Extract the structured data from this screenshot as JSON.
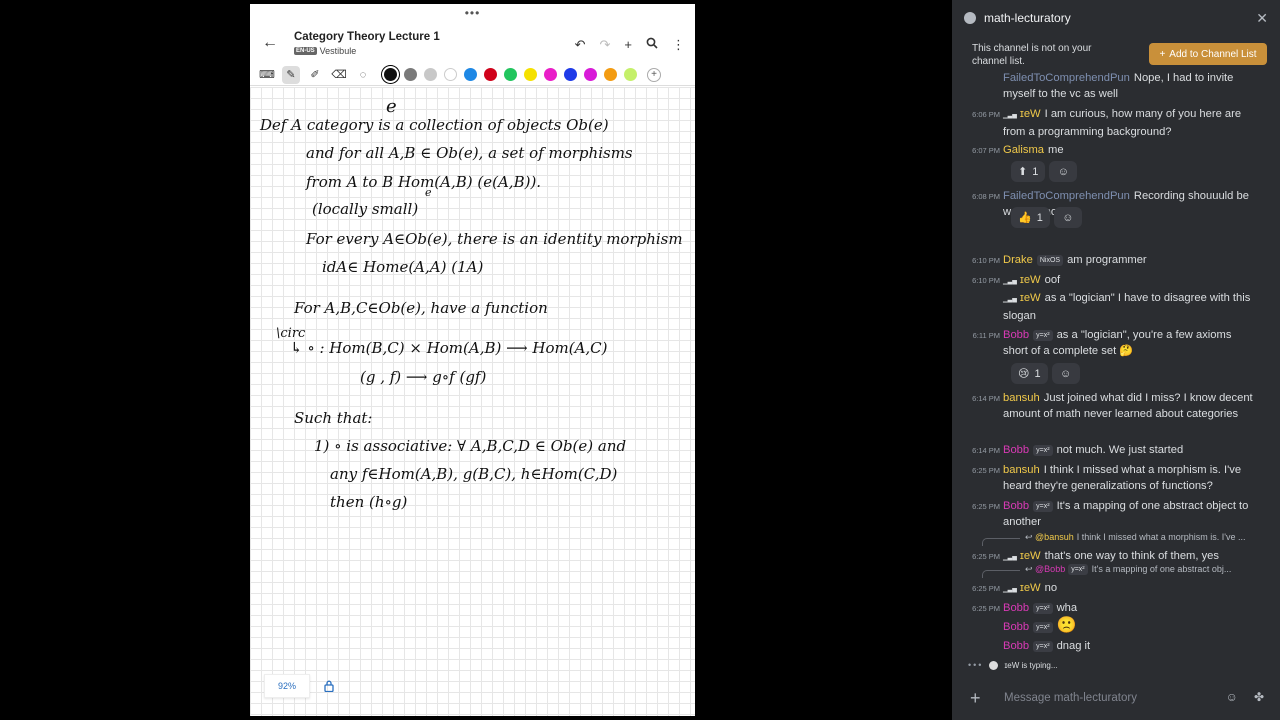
{
  "note": {
    "top_dots": "•••",
    "title": "Category Theory Lecture 1",
    "lang_badge": "EN-US",
    "notebook": "Vestibule",
    "zoom": "92%",
    "colors": [
      "#111111",
      "#7a7a7a",
      "#c8c8c8",
      "#ffffff",
      "#1e88e5",
      "#d0021b",
      "#22c55e",
      "#f5e100",
      "#e91ec8",
      "#1f3be8",
      "#d81bd8",
      "#f39c12",
      "#c5f06a"
    ],
    "handwriting": {
      "curly_e": "e",
      "l1": "Def   A category is a collection of objects Ob(e)",
      "l2": "and for all A,B ∈ Ob(e), a set of morphisms",
      "l3": "from A to B  Hom(A,B)  (e(A,B)).",
      "l3_sub": "e",
      "l4": "(locally small)",
      "l5": "For every A∈Ob(e), there is an identity morphism",
      "l6": "idA∈ Home(A,A)    (1A)",
      "l7": "For A,B,C∈Ob(e), have a function",
      "l8a": "\\circ",
      "l8": "↳ ∘ : Hom(B,C) × Hom(A,B) ⟶ Hom(A,C)",
      "l9": "(g  ,  f)        ⟶    g∘f     (gf)",
      "l10": "Such that:",
      "l11": "1)  ∘ is associative: ∀ A,B,C,D ∈ Ob(e) and",
      "l12": "any   f∈Hom(A,B), g(B,C), h∈Hom(C,D)",
      "l13": "then  (h∘g)"
    }
  },
  "chat": {
    "channel": "math-lecturatory",
    "notice": "This channel is not on your channel list.",
    "add_button": "Add to Channel List",
    "placeholder": "Message math-lecturatory",
    "typing": "ɪeW is typing...",
    "colors": {
      "FailedToComprehendPun": "#7e8fb0",
      "ɪeW": "#f0c94a",
      "Galisma": "#f0c94a",
      "Drake": "#f0c94a",
      "Bobb": "#d83ab5",
      "bansuh": "#f0c94a"
    },
    "messages": [
      {
        "time": "",
        "author": "FailedToComprehendPun",
        "text": "Nope, I had to invite myself to the vc as well"
      },
      {
        "time": "6:06 PM",
        "author": "ɪeW",
        "signal": true,
        "text": "I am curious, how many of you here are from a programming background?"
      },
      {
        "time": "6:07 PM",
        "author": "Galisma",
        "text": "me",
        "reactions": [
          {
            "emoji": "⬆",
            "count": "1"
          }
        ]
      },
      {
        "time": "6:08 PM",
        "author": "FailedToComprehendPun",
        "text": "Recording shouuuld be working now",
        "reactions": [
          {
            "emoji": "👍",
            "count": "1"
          }
        ]
      },
      {
        "time": "6:10 PM",
        "author": "Drake",
        "tag": "NixOS",
        "text": "am programmer"
      },
      {
        "time": "6:10 PM",
        "author": "ɪeW",
        "signal": true,
        "text": "oof"
      },
      {
        "time": "",
        "author": "ɪeW",
        "signal": true,
        "text": "as a \"logician\" I have to disagree with this slogan"
      },
      {
        "time": "6:11 PM",
        "author": "Bobb",
        "tag": "y=x²",
        "text": "as a \"logician\", you're a few axioms short of a complete set 🤔",
        "reactions": [
          {
            "emoji": "😢",
            "count": "1"
          }
        ]
      },
      {
        "time": "6:14 PM",
        "author": "bansuh",
        "text": "Just joined what did I miss? I know decent amount of math never learned about categories"
      },
      {
        "time": "6:14 PM",
        "author": "Bobb",
        "tag": "y=x²",
        "text": "not much. We just started"
      },
      {
        "time": "6:25 PM",
        "author": "bansuh",
        "text": "I think I missed what a morphism is. I've heard they're generalizations of functions?"
      },
      {
        "time": "6:25 PM",
        "author": "Bobb",
        "tag": "y=x²",
        "text": "It's a mapping of one abstract object to another"
      },
      {
        "time": "6:25 PM",
        "author": "ɪeW",
        "signal": true,
        "reply_to": "@bansuh",
        "reply_text": "I think I missed what a morphism is. I've ...",
        "text": "that's one way to think of them, yes"
      },
      {
        "time": "6:25 PM",
        "author": "ɪeW",
        "signal": true,
        "reply_to": "@Bobb",
        "reply_tag": "y=x²",
        "reply_text": "It's a mapping of one abstract obj...",
        "text": "no"
      },
      {
        "time": "6:25 PM",
        "author": "Bobb",
        "tag": "y=x²",
        "text": "wha"
      },
      {
        "time": "",
        "author": "Bobb",
        "tag": "y=x²",
        "text": "🙁"
      },
      {
        "time": "",
        "author": "Bobb",
        "tag": "y=x²",
        "text": "dnag it"
      }
    ]
  }
}
